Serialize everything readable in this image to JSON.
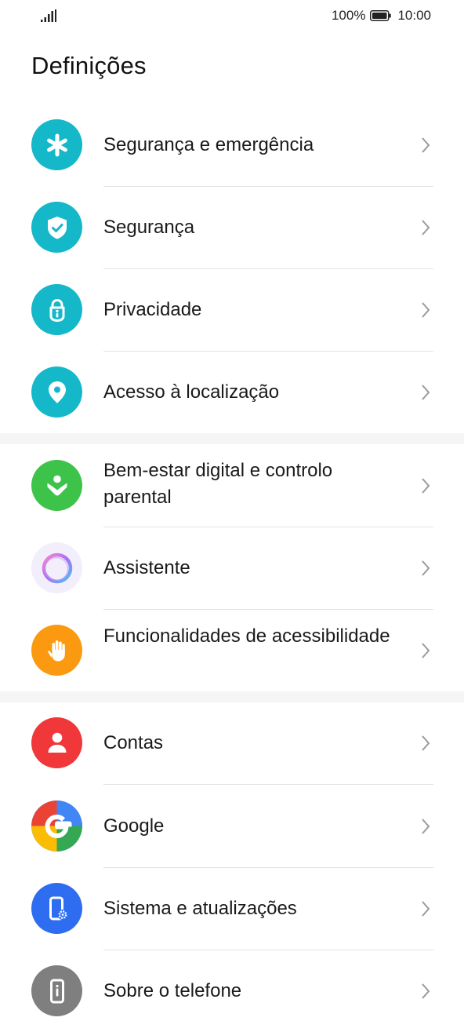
{
  "status_bar": {
    "battery_percent": "100%",
    "time": "10:00",
    "signal_icon": "signal-bars-icon",
    "battery_icon": "battery-full-icon"
  },
  "header": {
    "title": "Definições"
  },
  "items": [
    {
      "label": "Segurança e emergência",
      "icon": "asterisk-icon",
      "color": "#14b8c8"
    },
    {
      "label": "Segurança",
      "icon": "shield-check-icon",
      "color": "#14b8c8"
    },
    {
      "label": "Privacidade",
      "icon": "privacy-lock-icon",
      "color": "#14b8c8"
    },
    {
      "label": "Acesso à localização",
      "icon": "location-pin-icon",
      "color": "#14b8c8"
    },
    {
      "label": "Bem-estar digital e controlo parental",
      "icon": "digital-wellbeing-icon",
      "color": "#3ec34a"
    },
    {
      "label": "Assistente",
      "icon": "assistant-icon",
      "color": "#f3eefb"
    },
    {
      "label": "Funcionalidades de acessibilidade",
      "icon": "hand-icon",
      "color": "#fb9a10"
    },
    {
      "label": "Contas",
      "icon": "person-icon",
      "color": "#f0373a"
    },
    {
      "label": "Google",
      "icon": "google-icon",
      "color": "#4285f4"
    },
    {
      "label": "Sistema e atualizações",
      "icon": "phone-settings-icon",
      "color": "#2f6df0"
    },
    {
      "label": "Sobre o telefone",
      "icon": "phone-info-icon",
      "color": "#7f7f7f"
    }
  ]
}
